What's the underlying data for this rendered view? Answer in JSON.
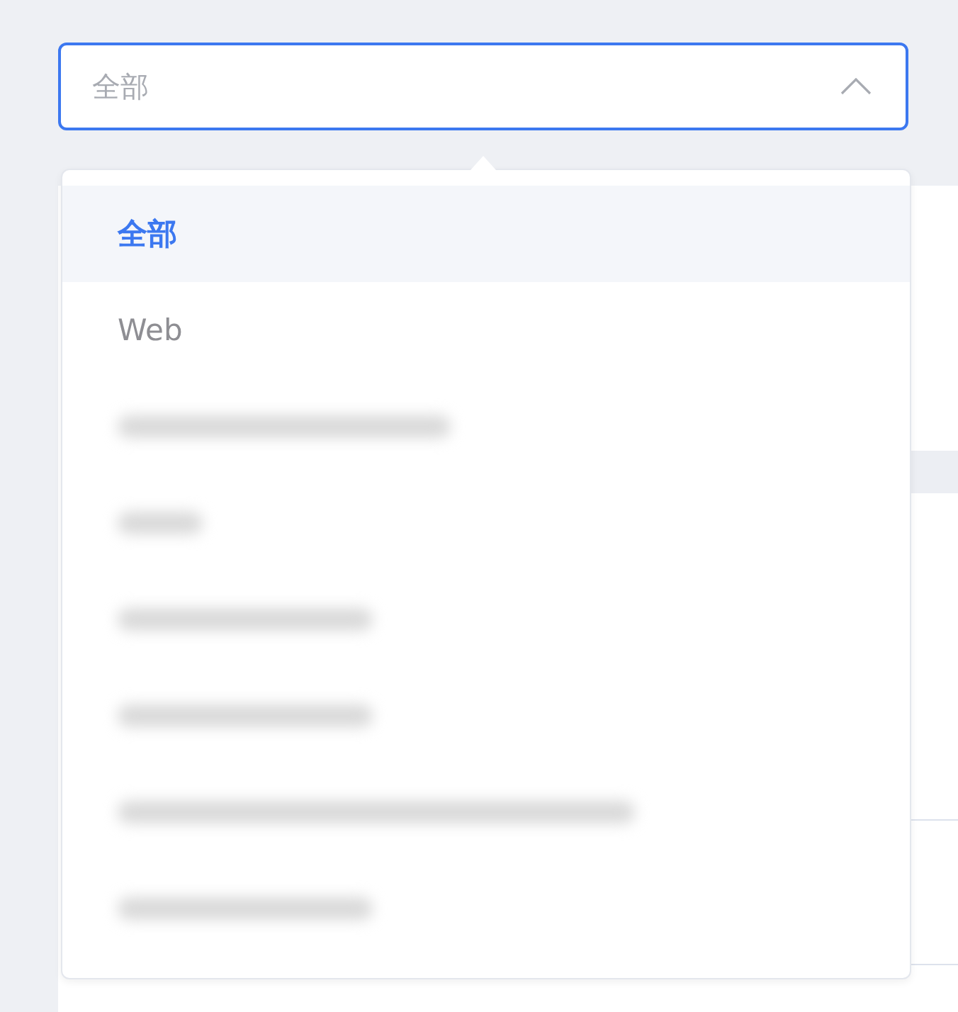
{
  "select": {
    "placeholder": "全部",
    "expanded": true
  },
  "options": [
    {
      "kind": "text",
      "label": "全部",
      "selected": true
    },
    {
      "kind": "text",
      "label": "Web",
      "selected": false
    },
    {
      "kind": "blurred",
      "selected": false
    },
    {
      "kind": "blurred",
      "selected": false
    },
    {
      "kind": "blurred",
      "selected": false
    },
    {
      "kind": "blurred",
      "selected": false
    },
    {
      "kind": "blurred",
      "selected": false
    },
    {
      "kind": "blurred",
      "selected": false
    }
  ]
}
